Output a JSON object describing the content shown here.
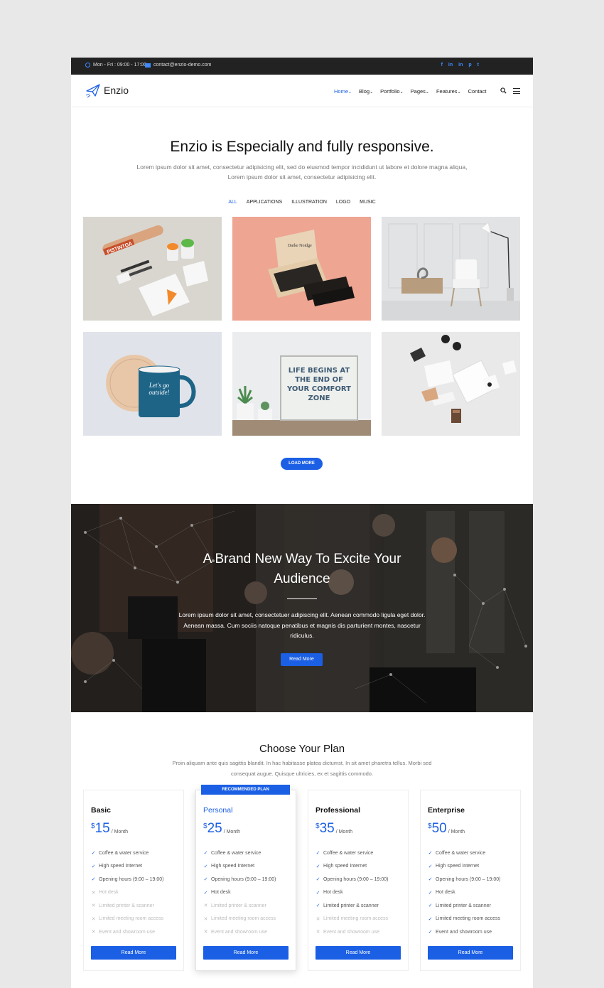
{
  "topbar": {
    "hours": "Mon - Fri : 09:00 - 17:00",
    "email": "contact@enzio-demo.com",
    "socials": [
      "f",
      "in",
      "in",
      "p",
      "t"
    ]
  },
  "brand": {
    "name": "Enzio"
  },
  "nav": {
    "items": [
      {
        "label": "Home",
        "caret": "⌄",
        "active": true
      },
      {
        "label": "Blog",
        "caret": "⌄"
      },
      {
        "label": "Portfolio",
        "caret": "⌄"
      },
      {
        "label": "Pages",
        "caret": "⌄"
      },
      {
        "label": "Features",
        "caret": "⌄"
      },
      {
        "label": "Contact",
        "caret": ""
      }
    ]
  },
  "portfolio": {
    "title": "Enzio is Especially and fully responsive.",
    "subtitle": "Lorem ipsum dolor sit amet, consectetur adipisicing elit, sed do eiusmod tempor incididunt ut labore et dolore magna aliqua, Lorem ipsum dolor sit amet, consectetur adipisicing elit.",
    "filters": [
      "ALL",
      "APPLICATIONS",
      "ILLUSTRATION",
      "LOGO",
      "MUSIC"
    ],
    "tiles": [
      {
        "name": "stationery-mockup",
        "sign_text": "PISTINTGA"
      },
      {
        "name": "business-cards-box",
        "sign_text": "Darke Noidge"
      },
      {
        "name": "chair-lamp-room",
        "sign_text": ""
      },
      {
        "name": "enamel-mug",
        "sign_text": "Let's go outside!"
      },
      {
        "name": "life-begins-sign",
        "sign_text": "LIFE BEGINS AT THE END OF YOUR COMFORT ZONE"
      },
      {
        "name": "brand-identity-kit",
        "sign_text": ""
      }
    ],
    "load_more": "LOAD MORE"
  },
  "hero": {
    "title_line1": "A Brand New Way To Excite Your",
    "title_line2": "Audience",
    "text": "Lorem ipsum dolor sit amet, consectetuer adipiscing elit. Aenean commodo ligula eget dolor. Aenean massa. Cum sociis natoque penatibus et magnis dis parturient montes, nascetur ridiculus.",
    "button": "Read More"
  },
  "pricing": {
    "title": "Choose Your Plan",
    "subtitle": "Proin aliquam ante quis sagittis blandit. In hac habitasse platea dictumst. In sit amet pharetra tellus. Morbi sed consequat augue. Quisque ultricies, ex et sagittis commodo.",
    "recommended_label": "RECOMMENDED PLAN",
    "currency": "$",
    "per": "/ Month",
    "button": "Read More",
    "features": [
      "Coffee & water service",
      "High speed Internet",
      "Opening hours (9:00 – 19:00)",
      "Hot desk",
      "Limited printer & scanner",
      "Limited meeting room access",
      "Event and showroom use"
    ],
    "plans": [
      {
        "name": "Basic",
        "price": "15",
        "included": [
          true,
          true,
          true,
          false,
          false,
          false,
          false
        ]
      },
      {
        "name": "Personal",
        "price": "25",
        "recommended": true,
        "included": [
          true,
          true,
          true,
          true,
          false,
          false,
          false
        ]
      },
      {
        "name": "Professional",
        "price": "35",
        "included": [
          true,
          true,
          true,
          true,
          true,
          false,
          false
        ]
      },
      {
        "name": "Enterprise",
        "price": "50",
        "included": [
          true,
          true,
          true,
          true,
          true,
          true,
          true
        ]
      }
    ]
  },
  "colors": {
    "accent": "#1b5fe5",
    "topbar": "#222222"
  }
}
